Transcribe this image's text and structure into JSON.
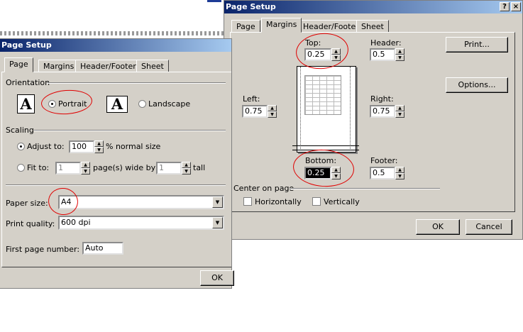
{
  "front_dialog": {
    "title": "Page Setup",
    "tabs": [
      "Page",
      "Margins",
      "Header/Footer",
      "Sheet"
    ],
    "orientation": {
      "group_label": "Orientation",
      "portrait_label": "Portrait",
      "landscape_label": "Landscape",
      "selected": "portrait"
    },
    "scaling": {
      "group_label": "Scaling",
      "adjust_label": "Adjust to:",
      "adjust_value": "100",
      "adjust_suffix": "% normal size",
      "fit_label": "Fit to:",
      "fit_wide_value": "1",
      "fit_wide_suffix": "page(s) wide by",
      "fit_tall_value": "1",
      "fit_tall_suffix": "tall"
    },
    "paper_size_label": "Paper size:",
    "paper_size_value": "A4",
    "print_quality_label": "Print quality:",
    "print_quality_value": "600 dpi",
    "first_page_label": "First page number:",
    "first_page_value": "Auto",
    "ok_label": "OK"
  },
  "back_dialog": {
    "title": "Page Setup",
    "help_glyph": "?",
    "close_glyph": "×",
    "tabs": [
      "Page",
      "Margins",
      "Header/Footer",
      "Sheet"
    ],
    "top_label": "Top:",
    "top_value": "0.25",
    "header_label": "Header:",
    "header_value": "0.5",
    "left_label": "Left:",
    "left_value": "0.75",
    "right_label": "Right:",
    "right_value": "0.75",
    "bottom_label": "Bottom:",
    "bottom_value": "0.25",
    "footer_label": "Footer:",
    "footer_value": "0.5",
    "center_label": "Center on page",
    "horizontally_label": "Horizontally",
    "vertically_label": "Vertically",
    "print_label": "Print...",
    "options_label": "Options...",
    "ok_label": "OK",
    "cancel_label": "Cancel"
  },
  "colors": {
    "dialog_face": "#d4d0c8",
    "title_start": "#0a246a",
    "title_end": "#a6caf0",
    "annotation": "#e00000"
  }
}
